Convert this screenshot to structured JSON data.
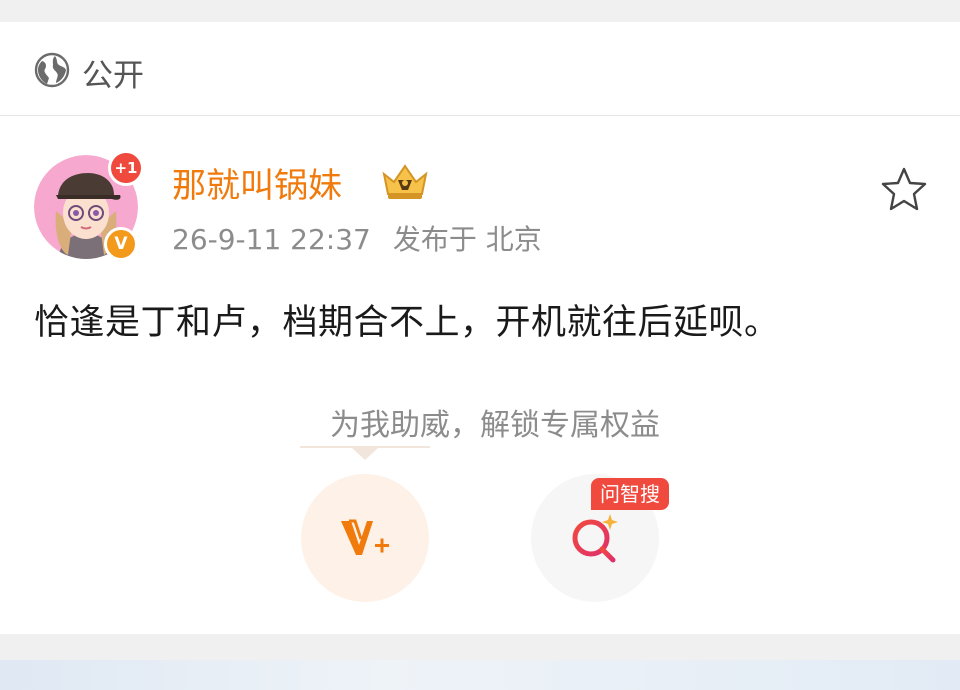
{
  "visibility": {
    "icon": "globe-icon",
    "label": "公开"
  },
  "author": {
    "name": "那就叫锅妹",
    "avatar": "avatar-girl-cap",
    "notification_badge": "+1",
    "verified_mark": "V",
    "member_icon": "crown-icon"
  },
  "post": {
    "timestamp": "26-9-11 22:37",
    "location": "发布于 北京",
    "text": "恰逢是丁和卢，档期合不上，开机就往后延呗。",
    "favorite_icon": "star-outline-icon"
  },
  "actions": {
    "boost_prompt": "为我助威，解锁专属权益",
    "vplus_icon": "v-plus-icon",
    "ai_search_icon": "sparkle-search-icon",
    "ai_search_tag": "问智搜"
  },
  "colors": {
    "accent_orange": "#f07a0c",
    "badge_red": "#f04a3e",
    "verified_orange": "#f39a1c",
    "muted_text": "#8c8c8c"
  }
}
